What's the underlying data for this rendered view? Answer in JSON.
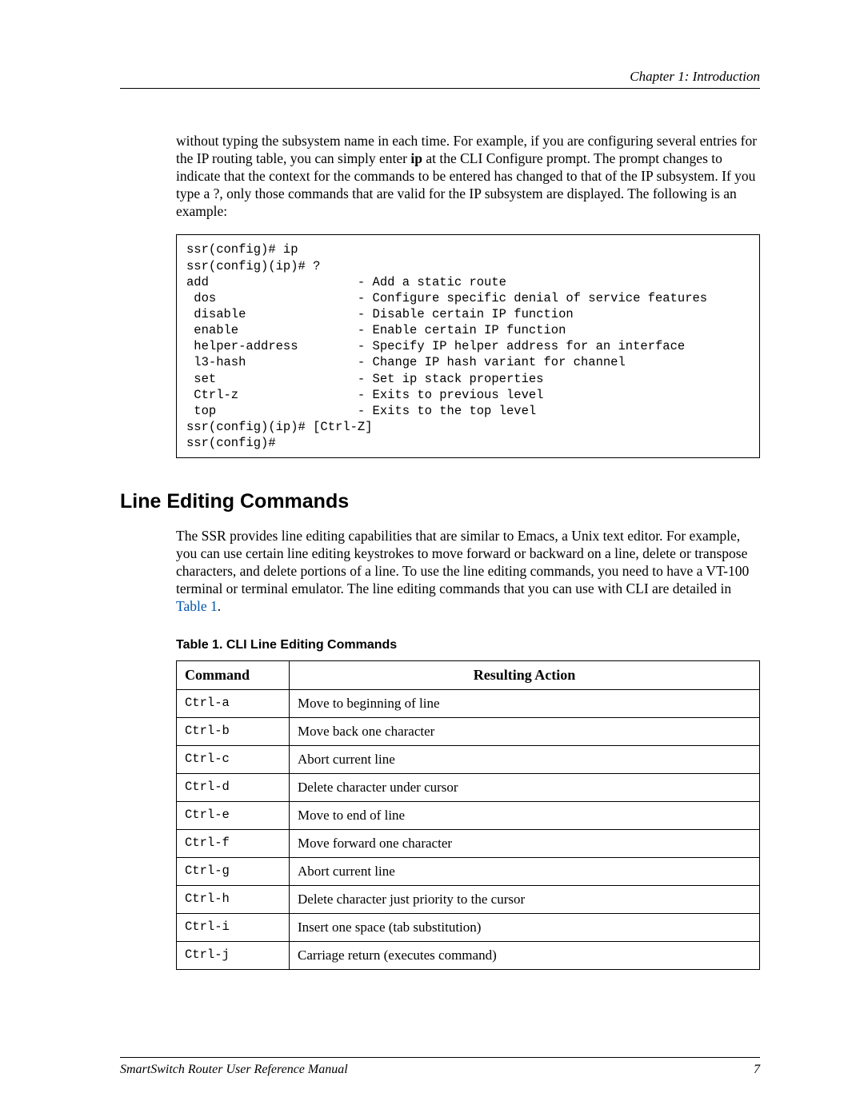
{
  "header": {
    "chapter": "Chapter 1: Introduction"
  },
  "intro_paragraph": {
    "pre_bold": "without typing the subsystem name in each time. For example, if you are configuring several entries for the IP routing table, you can simply enter ",
    "bold": "ip",
    "post_bold": " at the CLI Configure prompt. The prompt changes to indicate that the context for the commands to be entered has changed to that of the IP subsystem. If you type a ?, only those commands that are valid for the IP subsystem are displayed. The following is an example:"
  },
  "code_block": "ssr(config)# ip\nssr(config)(ip)# ?\nadd                    - Add a static route\n dos                   - Configure specific denial of service features\n disable               - Disable certain IP function\n enable                - Enable certain IP function\n helper-address        - Specify IP helper address for an interface\n l3-hash               - Change IP hash variant for channel\n set                   - Set ip stack properties\n Ctrl-z                - Exits to previous level\n top                   - Exits to the top level\nssr(config)(ip)# [Ctrl-Z]\nssr(config)#",
  "section_heading": "Line Editing Commands",
  "section_paragraph": {
    "pre_link": "The SSR provides line editing capabilities that are similar to Emacs, a Unix text editor. For example, you can use certain line editing keystrokes to move forward or backward on a line, delete or transpose characters, and delete portions of a line. To use the line editing commands, you need to have a VT-100 terminal or terminal emulator. The line editing commands that you can use with CLI are detailed in ",
    "link": "Table 1",
    "post_link": "."
  },
  "table": {
    "caption": "Table 1.  CLI Line Editing Commands",
    "headers": {
      "command": "Command",
      "action": "Resulting Action"
    },
    "rows": [
      {
        "command": "Ctrl-a",
        "action": "Move to beginning of line"
      },
      {
        "command": "Ctrl-b",
        "action": "Move back one character"
      },
      {
        "command": "Ctrl-c",
        "action": "Abort current line"
      },
      {
        "command": "Ctrl-d",
        "action": "Delete character under cursor"
      },
      {
        "command": "Ctrl-e",
        "action": "Move to end of line"
      },
      {
        "command": "Ctrl-f",
        "action": "Move forward one character"
      },
      {
        "command": "Ctrl-g",
        "action": "Abort current line"
      },
      {
        "command": "Ctrl-h",
        "action": "Delete character just priority to the cursor"
      },
      {
        "command": "Ctrl-i",
        "action": "Insert one space (tab substitution)"
      },
      {
        "command": "Ctrl-j",
        "action": "Carriage return (executes command)"
      }
    ]
  },
  "footer": {
    "title": "SmartSwitch Router User Reference Manual",
    "page": "7"
  }
}
